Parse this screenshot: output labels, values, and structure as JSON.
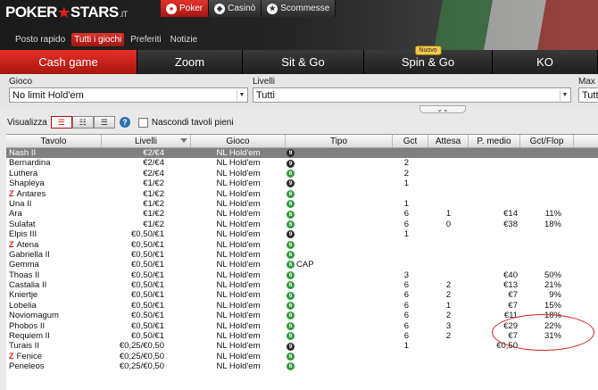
{
  "brand": {
    "logo_left": "POKER",
    "logo_star": "★",
    "logo_right": "STARS",
    "logo_tld": ".IT"
  },
  "product_tabs": [
    {
      "label": "Poker",
      "icon": "poker-spade-icon",
      "glyph": "♠",
      "active": true
    },
    {
      "label": "Casinò",
      "icon": "casino-dice-icon",
      "glyph": "◆",
      "active": false
    },
    {
      "label": "Scommesse",
      "icon": "sports-star-icon",
      "glyph": "★",
      "active": false
    }
  ],
  "subnav": [
    {
      "label": "Posto rapido",
      "active": false
    },
    {
      "label": "Tutti i giochi",
      "active": true
    },
    {
      "label": "Preferiti",
      "active": false
    },
    {
      "label": "Notizie",
      "active": false
    }
  ],
  "game_tabs": [
    {
      "label": "Cash game",
      "active": true,
      "badge": ""
    },
    {
      "label": "Zoom",
      "active": false,
      "badge": ""
    },
    {
      "label": "Sit & Go",
      "active": false,
      "badge": ""
    },
    {
      "label": "Spin & Go",
      "active": false,
      "badge": "Nuovo"
    },
    {
      "label": "KO",
      "active": false,
      "badge": ""
    }
  ],
  "filters": {
    "game_label": "Gioco",
    "game_value": "No limit Hold'em",
    "level_label": "Livelli",
    "level_value": "Tutti",
    "max_label": "Max",
    "max_value": "Tutti",
    "expander_glyph": "⌄⌄"
  },
  "view": {
    "label": "Visualizza",
    "help": "?",
    "hide_full_label": "Nascondi tavoli pieni",
    "hide_full_checked": false
  },
  "table": {
    "headers": {
      "name": "Tavolo",
      "stakes": "Livelli",
      "game": "Gioco",
      "type": "Tipo",
      "players": "Gct",
      "waiting": "Attesa",
      "avg_pot": "P. medio",
      "players_flop": "Gct/Flop"
    },
    "rows": [
      {
        "name": "Nash II",
        "zoom": false,
        "stakes": "€2/€4",
        "game": "NL Hold'em",
        "seats": "9",
        "cap": "",
        "players": "",
        "waiting": "",
        "avg_pot": "",
        "players_flop": "",
        "selected": true
      },
      {
        "name": "Bernardina",
        "zoom": false,
        "stakes": "€2/€4",
        "game": "NL Hold'em",
        "seats": "9",
        "cap": "",
        "players": "2",
        "waiting": "",
        "avg_pot": "",
        "players_flop": "",
        "selected": false
      },
      {
        "name": "Luthera",
        "zoom": false,
        "stakes": "€2/€4",
        "game": "NL Hold'em",
        "seats": "6",
        "cap": "",
        "players": "2",
        "waiting": "",
        "avg_pot": "",
        "players_flop": "",
        "selected": false
      },
      {
        "name": "Shapleya",
        "zoom": false,
        "stakes": "€1/€2",
        "game": "NL Hold'em",
        "seats": "9",
        "cap": "",
        "players": "1",
        "waiting": "",
        "avg_pot": "",
        "players_flop": "",
        "selected": false
      },
      {
        "name": "Antares",
        "zoom": true,
        "stakes": "€1/€2",
        "game": "NL Hold'em",
        "seats": "6",
        "cap": "",
        "players": "",
        "waiting": "",
        "avg_pot": "",
        "players_flop": "",
        "selected": false
      },
      {
        "name": "Una II",
        "zoom": false,
        "stakes": "€1/€2",
        "game": "NL Hold'em",
        "seats": "6",
        "cap": "",
        "players": "1",
        "waiting": "",
        "avg_pot": "",
        "players_flop": "",
        "selected": false
      },
      {
        "name": "Ara",
        "zoom": false,
        "stakes": "€1/€2",
        "game": "NL Hold'em",
        "seats": "6",
        "cap": "",
        "players": "6",
        "waiting": "1",
        "avg_pot": "€14",
        "players_flop": "11%",
        "selected": false
      },
      {
        "name": "Sulafat",
        "zoom": false,
        "stakes": "€1/€2",
        "game": "NL Hold'em",
        "seats": "6",
        "cap": "",
        "players": "6",
        "waiting": "0",
        "avg_pot": "€38",
        "players_flop": "18%",
        "selected": false
      },
      {
        "name": "Elpis III",
        "zoom": false,
        "stakes": "€0,50/€1",
        "game": "NL Hold'em",
        "seats": "9",
        "cap": "",
        "players": "1",
        "waiting": "",
        "avg_pot": "",
        "players_flop": "",
        "selected": false
      },
      {
        "name": "Atena",
        "zoom": true,
        "stakes": "€0,50/€1",
        "game": "NL Hold'em",
        "seats": "6",
        "cap": "",
        "players": "",
        "waiting": "",
        "avg_pot": "",
        "players_flop": "",
        "selected": false
      },
      {
        "name": "Gabriella II",
        "zoom": false,
        "stakes": "€0,50/€1",
        "game": "NL Hold'em",
        "seats": "6",
        "cap": "",
        "players": "",
        "waiting": "",
        "avg_pot": "",
        "players_flop": "",
        "selected": false
      },
      {
        "name": "Gemma",
        "zoom": false,
        "stakes": "€0,50/€1",
        "game": "NL Hold'em",
        "seats": "6",
        "cap": "CAP",
        "players": "",
        "waiting": "",
        "avg_pot": "",
        "players_flop": "",
        "selected": false
      },
      {
        "name": "Thoas II",
        "zoom": false,
        "stakes": "€0,50/€1",
        "game": "NL Hold'em",
        "seats": "6",
        "cap": "",
        "players": "3",
        "waiting": "",
        "avg_pot": "€40",
        "players_flop": "50%",
        "selected": false
      },
      {
        "name": "Castalia II",
        "zoom": false,
        "stakes": "€0,50/€1",
        "game": "NL Hold'em",
        "seats": "6",
        "cap": "",
        "players": "6",
        "waiting": "2",
        "avg_pot": "€13",
        "players_flop": "21%",
        "selected": false
      },
      {
        "name": "Kniertje",
        "zoom": false,
        "stakes": "€0,50/€1",
        "game": "NL Hold'em",
        "seats": "6",
        "cap": "",
        "players": "6",
        "waiting": "2",
        "avg_pot": "€7",
        "players_flop": "9%",
        "selected": false
      },
      {
        "name": "Lobelia",
        "zoom": false,
        "stakes": "€0,50/€1",
        "game": "NL Hold'em",
        "seats": "6",
        "cap": "",
        "players": "6",
        "waiting": "1",
        "avg_pot": "€7",
        "players_flop": "15%",
        "selected": false
      },
      {
        "name": "Noviomagum",
        "zoom": false,
        "stakes": "€0,50/€1",
        "game": "NL Hold'em",
        "seats": "6",
        "cap": "",
        "players": "6",
        "waiting": "2",
        "avg_pot": "€11",
        "players_flop": "18%",
        "selected": false
      },
      {
        "name": "Phobos II",
        "zoom": false,
        "stakes": "€0,50/€1",
        "game": "NL Hold'em",
        "seats": "6",
        "cap": "",
        "players": "6",
        "waiting": "3",
        "avg_pot": "€29",
        "players_flop": "22%",
        "selected": false
      },
      {
        "name": "Requiem II",
        "zoom": false,
        "stakes": "€0,50/€1",
        "game": "NL Hold'em",
        "seats": "6",
        "cap": "",
        "players": "6",
        "waiting": "2",
        "avg_pot": "€7",
        "players_flop": "31%",
        "selected": false
      },
      {
        "name": "Turais II",
        "zoom": false,
        "stakes": "€0,25/€0,50",
        "game": "NL Hold'em",
        "seats": "9",
        "cap": "",
        "players": "1",
        "waiting": "",
        "avg_pot": "€0,50",
        "players_flop": "",
        "selected": false
      },
      {
        "name": "Fenice",
        "zoom": true,
        "stakes": "€0,25/€0,50",
        "game": "NL Hold'em",
        "seats": "6",
        "cap": "",
        "players": "",
        "waiting": "",
        "avg_pot": "",
        "players_flop": "",
        "selected": false
      },
      {
        "name": "Peneleos",
        "zoom": false,
        "stakes": "€0,25/€0,50",
        "game": "NL Hold'em",
        "seats": "6",
        "cap": "",
        "players": "",
        "waiting": "",
        "avg_pot": "",
        "players_flop": "",
        "selected": false
      }
    ]
  },
  "colors": {
    "accent": "#d7261e",
    "six_max": "#2f9a3a",
    "nine_max": "#2a2a2a",
    "selected_row": "#808080",
    "annotation": "#d42020"
  }
}
